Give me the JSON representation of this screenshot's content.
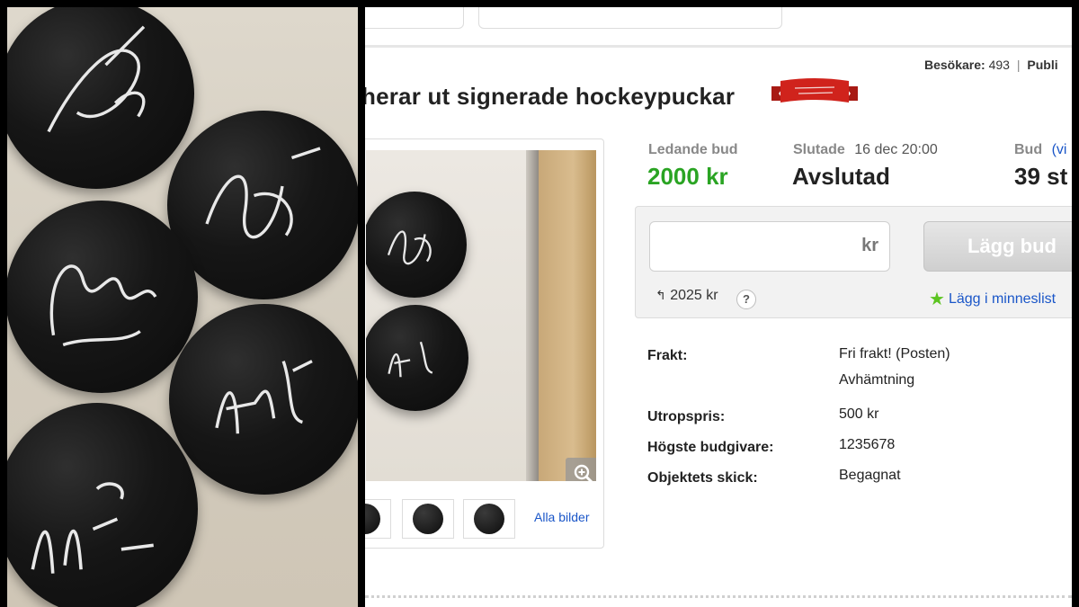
{
  "page": {
    "visitors_label": "Besökare:",
    "visitors_count": "493",
    "visitors_next": "Publi",
    "title": "herar ut signerade hockeypuckar"
  },
  "bid_info": {
    "leading_label": "Ledande bud",
    "leading_value": "2000 kr",
    "ended_label": "Slutade",
    "ended_date": "16 dec 20:00",
    "ended_status": "Avslutad",
    "bids_label": "Bud",
    "bids_link": "(vi",
    "bids_value": "39 st"
  },
  "bid_form": {
    "input_value": "",
    "currency": "kr",
    "button_label": "Lägg bud",
    "min_bid": "2025 kr",
    "help": "?",
    "watchlist": "Lägg i minneslist"
  },
  "gallery": {
    "all_images_label": "Alla bilder"
  },
  "details": [
    {
      "label": "Frakt:",
      "value": "Fri frakt! (Posten)"
    },
    {
      "label": "",
      "value": "Avhämtning"
    },
    {
      "label": "Utropspris:",
      "value": "500 kr"
    },
    {
      "label": "Högste budgivare:",
      "value": "1235678"
    },
    {
      "label": "Objektets skick:",
      "value": "Begagnat"
    }
  ],
  "colors": {
    "green": "#2aa423",
    "link": "#1a56c8",
    "ribbon": "#d0231c"
  }
}
